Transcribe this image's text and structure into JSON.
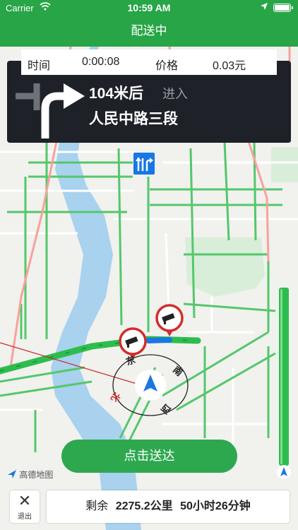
{
  "status_bar": {
    "carrier": "Carrier",
    "time": "10:59 AM"
  },
  "nav": {
    "title": "配送中"
  },
  "stats": {
    "time_label": "时间",
    "time_value": "0:00:08",
    "price_label": "价格",
    "price_value": "0.03元"
  },
  "guide": {
    "distance": "104米后",
    "action": "进入",
    "road": "人民中路三段",
    "turn_icon": "turn-right-icon"
  },
  "compass": {
    "east": "东",
    "south": "南",
    "west": "西",
    "north": "北"
  },
  "deliver_button": {
    "label": "点击送达"
  },
  "map_logo": {
    "text": "高德地图"
  },
  "exit": {
    "label": "退出"
  },
  "remaining": {
    "label": "剩余",
    "distance": "2275.2公里",
    "duration": "50小时26分钟"
  },
  "colors": {
    "accent": "#27a547",
    "guide_bg": "#1e2128",
    "route_green": "#2dbd4e",
    "lane_blue": "#1877e6"
  }
}
